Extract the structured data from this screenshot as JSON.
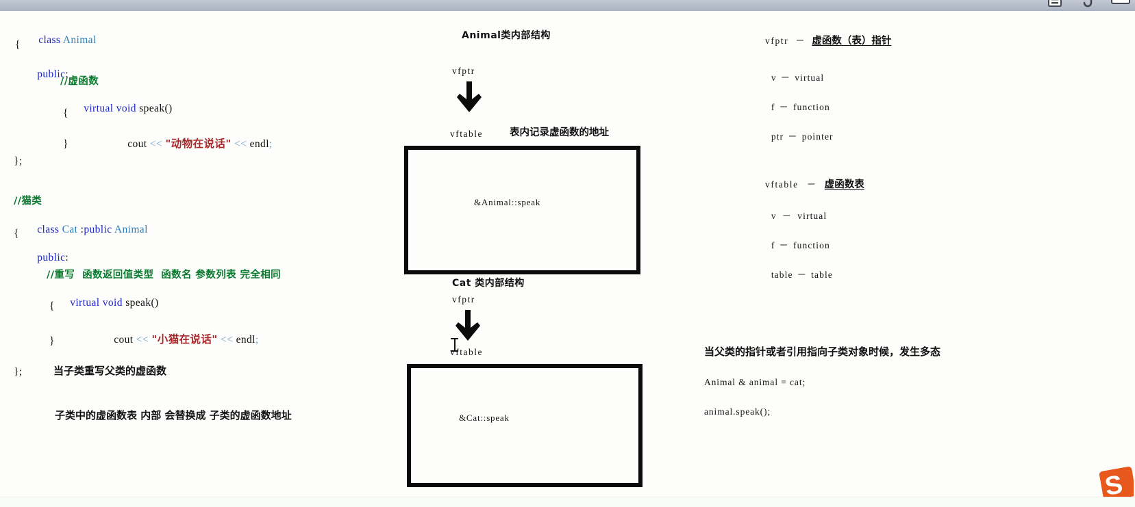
{
  "window": {
    "toolbar_icons": [
      "save-icon",
      "undo-icon",
      "minimize-icon"
    ]
  },
  "code": {
    "animal": [
      {
        "indent": 0,
        "tokens": [
          {
            "t": "class ",
            "c": "kw"
          },
          {
            "t": "Animal",
            "c": "type"
          }
        ]
      },
      {
        "indent": 0,
        "tokens": [
          {
            "t": "{",
            "c": "plain"
          }
        ]
      },
      {
        "indent": 0,
        "tokens": [
          {
            "t": "public",
            "c": "kw"
          },
          {
            "t": ":",
            "c": "plain"
          }
        ]
      },
      {
        "indent": 4,
        "tokens": [
          {
            "t": "//虚函数",
            "c": "comment"
          }
        ]
      },
      {
        "indent": 4,
        "tokens": [
          {
            "t": "virtual ",
            "c": "kw"
          },
          {
            "t": "void ",
            "c": "kw"
          },
          {
            "t": "speak()",
            "c": "plain"
          }
        ]
      },
      {
        "indent": 4,
        "tokens": [
          {
            "t": "{",
            "c": "plain"
          }
        ]
      },
      {
        "indent": 8,
        "tokens": [
          {
            "t": "cout ",
            "c": "plain"
          },
          {
            "t": "<< ",
            "c": "op"
          },
          {
            "t": "\"动物在说话\"",
            "c": "str"
          },
          {
            "t": " << ",
            "c": "op"
          },
          {
            "t": "endl;",
            "c": "plain"
          }
        ]
      },
      {
        "indent": 4,
        "tokens": [
          {
            "t": "}",
            "c": "plain"
          }
        ]
      },
      {
        "indent": 0,
        "tokens": [
          {
            "t": "};",
            "c": "plain"
          }
        ]
      }
    ],
    "cat": [
      {
        "indent": 0,
        "tokens": [
          {
            "t": "//猫类",
            "c": "comment"
          }
        ]
      },
      {
        "indent": 0,
        "tokens": [
          {
            "t": "class ",
            "c": "kw"
          },
          {
            "t": "Cat ",
            "c": "type"
          },
          {
            "t": ":",
            "c": "plain"
          },
          {
            "t": "public ",
            "c": "kw"
          },
          {
            "t": "Animal",
            "c": "type"
          }
        ]
      },
      {
        "indent": 0,
        "tokens": [
          {
            "t": "{",
            "c": "plain"
          }
        ]
      },
      {
        "indent": 0,
        "tokens": [
          {
            "t": "public",
            "c": "kw"
          },
          {
            "t": ":",
            "c": "plain"
          }
        ]
      },
      {
        "indent": 3,
        "tokens": [
          {
            "t": "//重写  函数返回值类型  函数名 参数列表 完全相同",
            "c": "comment"
          }
        ]
      },
      {
        "indent": 3,
        "tokens": [
          {
            "t": "virtual ",
            "c": "kw"
          },
          {
            "t": "void ",
            "c": "kw"
          },
          {
            "t": "speak()",
            "c": "plain"
          }
        ]
      },
      {
        "indent": 3,
        "tokens": [
          {
            "t": "{",
            "c": "plain"
          }
        ]
      },
      {
        "indent": 7,
        "tokens": [
          {
            "t": "cout ",
            "c": "plain"
          },
          {
            "t": "<< ",
            "c": "op"
          },
          {
            "t": "\"小猫在说话\"",
            "c": "str"
          },
          {
            "t": " << ",
            "c": "op"
          },
          {
            "t": "endl;",
            "c": "plain"
          }
        ]
      },
      {
        "indent": 3,
        "tokens": [
          {
            "t": "}",
            "c": "plain"
          }
        ]
      },
      {
        "indent": 0,
        "tokens": [
          {
            "t": "};",
            "c": "plain"
          }
        ]
      }
    ],
    "notes_left": [
      "当子类重写父类的虚函数",
      "子类中的虚函数表 内部 会替换成 子类的虚函数地址"
    ]
  },
  "diagram": {
    "animal": {
      "title": "Animal类内部结构",
      "pointer_label": "vfptr",
      "table_label": "vftable",
      "table_note": "表内记录虚函数的地址",
      "entry": "&Animal::speak"
    },
    "cat": {
      "title": "Cat 类内部结构",
      "pointer_label": "vfptr",
      "table_label": "vftable",
      "entry": "&Cat::speak"
    }
  },
  "legend": {
    "vfptr": {
      "term": "vfptr",
      "dash": "－",
      "meaning": "虚函数（表）指针",
      "parts": [
        {
          "abbr": "v",
          "dash": "－",
          "word": "virtual"
        },
        {
          "abbr": "f",
          "dash": "－",
          "word": "function"
        },
        {
          "abbr": "ptr",
          "dash": "－",
          "word": "pointer"
        }
      ]
    },
    "vftable": {
      "term": "vftable",
      "dash": "－",
      "meaning": "虚函数表",
      "parts": [
        {
          "abbr": "v",
          "dash": "－",
          "word": "virtual"
        },
        {
          "abbr": "f",
          "dash": "－",
          "word": "function"
        },
        {
          "abbr": "table",
          "dash": "－",
          "word": "table"
        }
      ]
    }
  },
  "polymorphism": {
    "statement": "当父类的指针或者引用指向子类对象时候，发生多态",
    "code_lines": [
      "Animal & animal = cat;",
      "animal.speak();"
    ]
  },
  "colors": {
    "keyword": "#1c24c4",
    "type": "#2e7fb8",
    "comment": "#0a7a2f",
    "string": "#a8272a",
    "ink": "#111111",
    "page": "#fdfefb",
    "logo": "#e8581c"
  }
}
